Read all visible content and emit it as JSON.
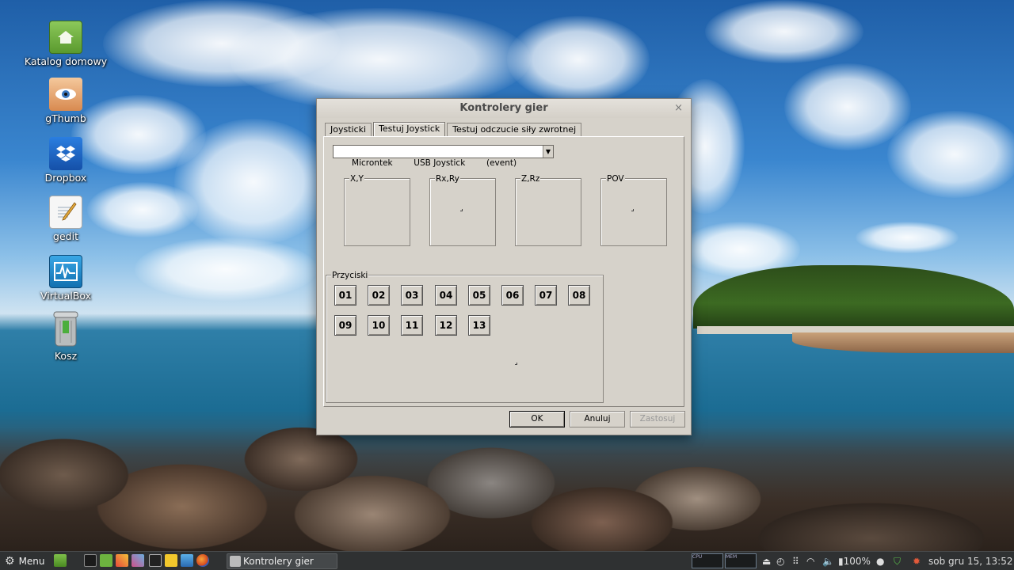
{
  "desktop": {
    "icons": [
      {
        "label": "Katalog domowy",
        "icon": "home-folder-icon",
        "color": "#6aa83a"
      },
      {
        "label": "gThumb",
        "icon": "gthumb-eye-icon",
        "color": "#e3a06a"
      },
      {
        "label": "Dropbox",
        "icon": "dropbox-icon",
        "color": "#1e63c4"
      },
      {
        "label": "gedit",
        "icon": "gedit-notepad-icon",
        "color": "#f2f2f2"
      },
      {
        "label": "VirtualBox",
        "icon": "virtualbox-icon",
        "color": "#1a8ac9"
      },
      {
        "label": "Kosz",
        "icon": "trash-icon",
        "color": "#9a9a9a"
      }
    ]
  },
  "dialog": {
    "title": "Kontrolery gier",
    "close": "×",
    "tabs": [
      "Joysticki",
      "Testuj Joystick",
      "Testuj odczucie siły zwrotnej"
    ],
    "active_tab": 1,
    "device_select": "Microntek        USB Joystick        (event)",
    "axes": [
      "X,Y",
      "Rx,Ry",
      "Z,Rz",
      "POV"
    ],
    "buttons_group": "Przyciski",
    "buttons": [
      "01",
      "02",
      "03",
      "04",
      "05",
      "06",
      "07",
      "08",
      "09",
      "10",
      "11",
      "12",
      "13"
    ],
    "ok": "OK",
    "cancel": "Anuluj",
    "apply": "Zastosuj"
  },
  "taskbar": {
    "menu": "Menu",
    "task_window": "Kontrolery gier",
    "graph_labels": [
      "CPU",
      "MEM"
    ],
    "battery": "100%",
    "clock": "sob gru 15, 13:52"
  }
}
